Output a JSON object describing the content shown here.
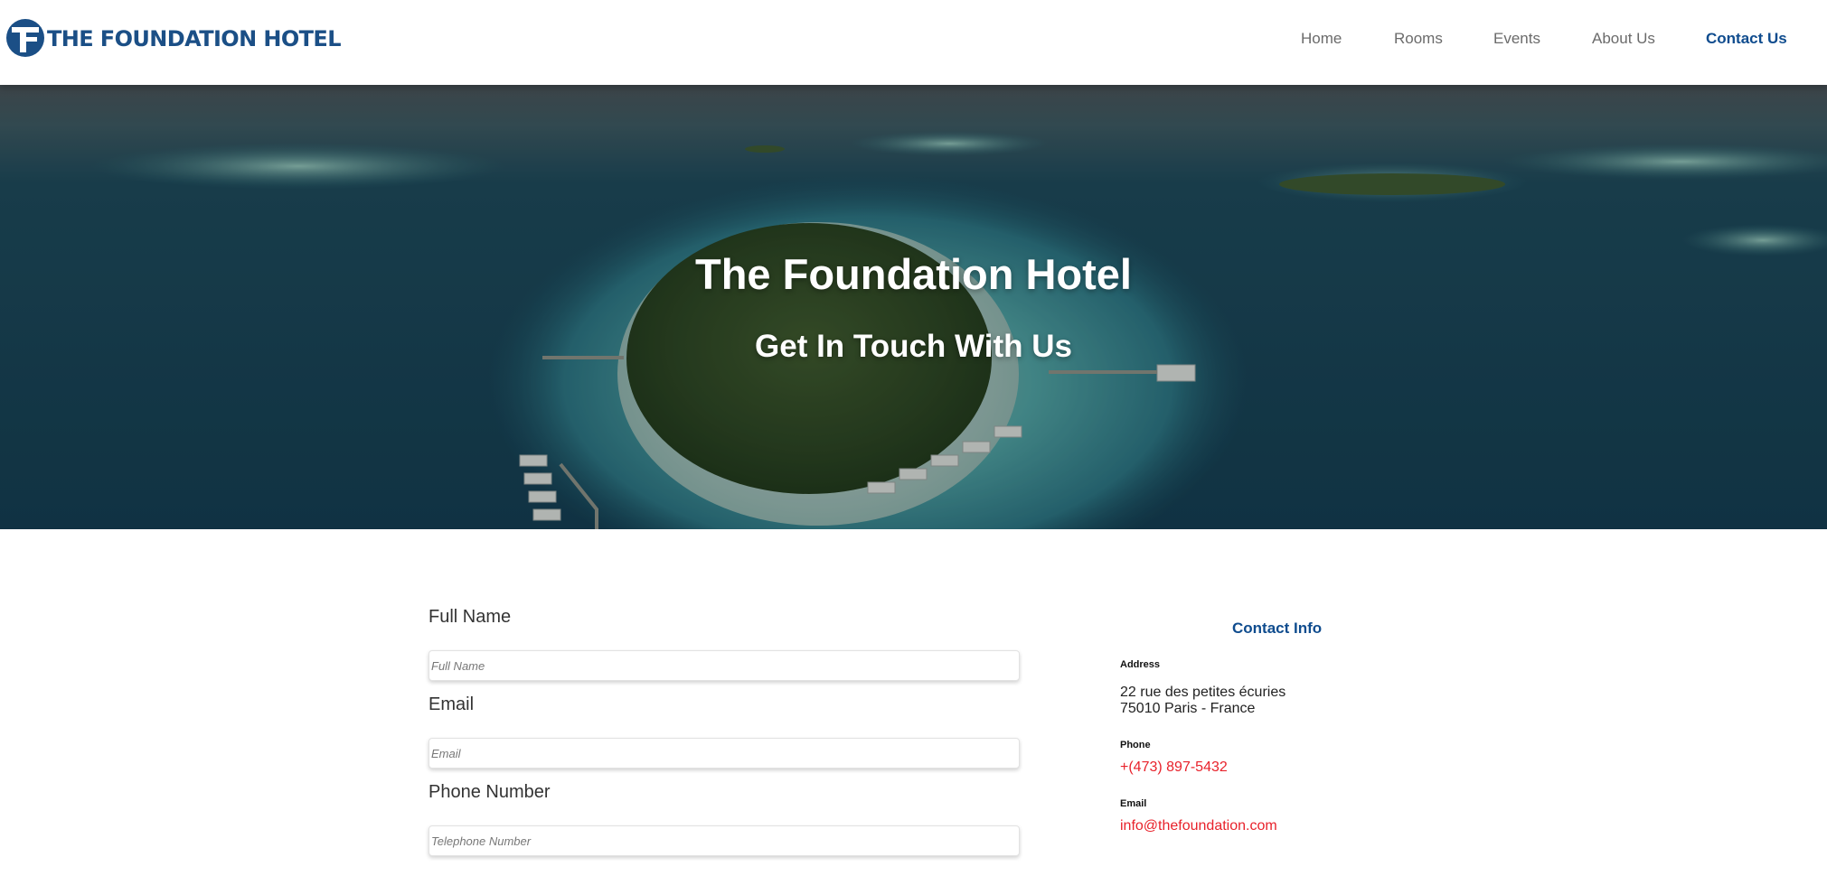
{
  "brand": {
    "logo_text": "THE FOUNDATION HOTEL",
    "logo_letter": "TF",
    "primary_color": "#1b4f86",
    "accent_color": "#e8222b"
  },
  "nav": {
    "items": [
      {
        "label": "Home",
        "active": false
      },
      {
        "label": "Rooms",
        "active": false
      },
      {
        "label": "Events",
        "active": false
      },
      {
        "label": "About Us",
        "active": false
      },
      {
        "label": "Contact Us",
        "active": true
      }
    ]
  },
  "hero": {
    "title": "The Foundation Hotel",
    "subtitle": "Get In Touch With Us"
  },
  "form": {
    "full_name": {
      "label": "Full Name",
      "placeholder": "Full Name",
      "value": ""
    },
    "email": {
      "label": "Email",
      "placeholder": "Email",
      "value": ""
    },
    "phone": {
      "label": "Phone Number",
      "placeholder": "Telephone Number",
      "value": ""
    }
  },
  "contact_info": {
    "heading": "Contact Info",
    "address_label": "Address",
    "address_line1": "22 rue des petites écuries",
    "address_line2": "75010 Paris - France",
    "phone_label": "Phone",
    "phone_value": "+(473) 897-5432",
    "email_label": "Email",
    "email_value": "info@thefoundation.com"
  }
}
